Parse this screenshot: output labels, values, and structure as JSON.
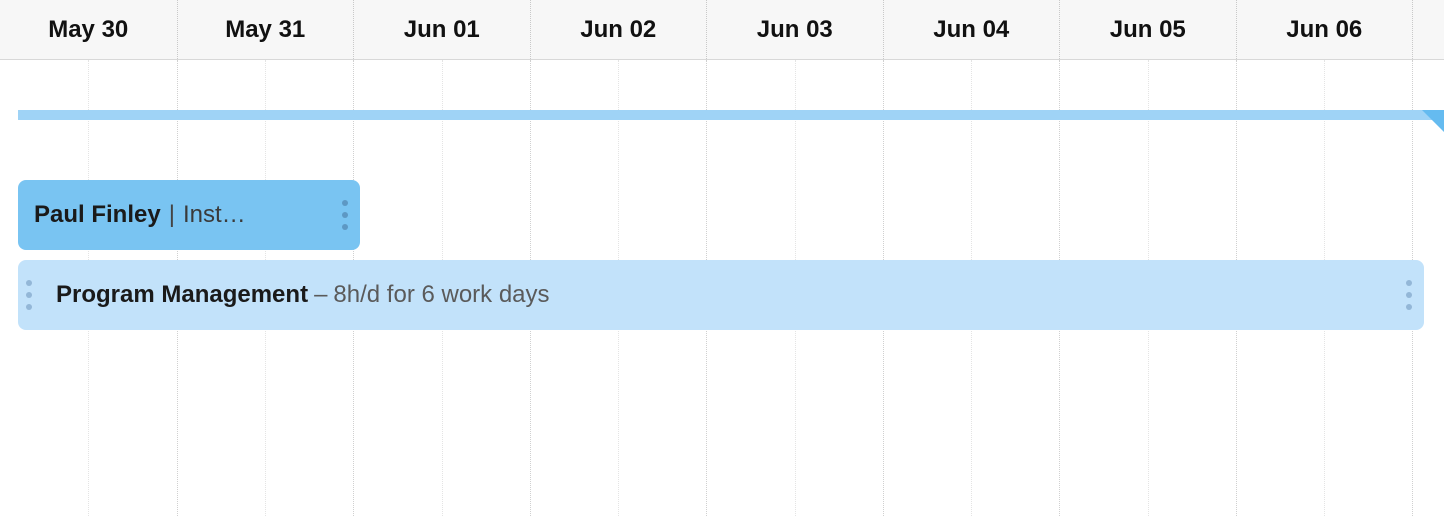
{
  "timeline": {
    "days": [
      "May 30",
      "May 31",
      "Jun 01",
      "Jun 02",
      "Jun 03",
      "Jun 04",
      "Jun 05",
      "Jun 06"
    ]
  },
  "tasks": {
    "t1": {
      "title": "Paul Finley",
      "subtitle": "Inst…"
    },
    "t2": {
      "title": "Program Management",
      "separator": "–",
      "detail": "8h/d for 6 work days"
    }
  },
  "colors": {
    "range_bar": "#9fd3f6",
    "range_corner": "#65bbf0",
    "task1_bg": "#79c4f2",
    "task2_bg": "#c2e2fa"
  }
}
